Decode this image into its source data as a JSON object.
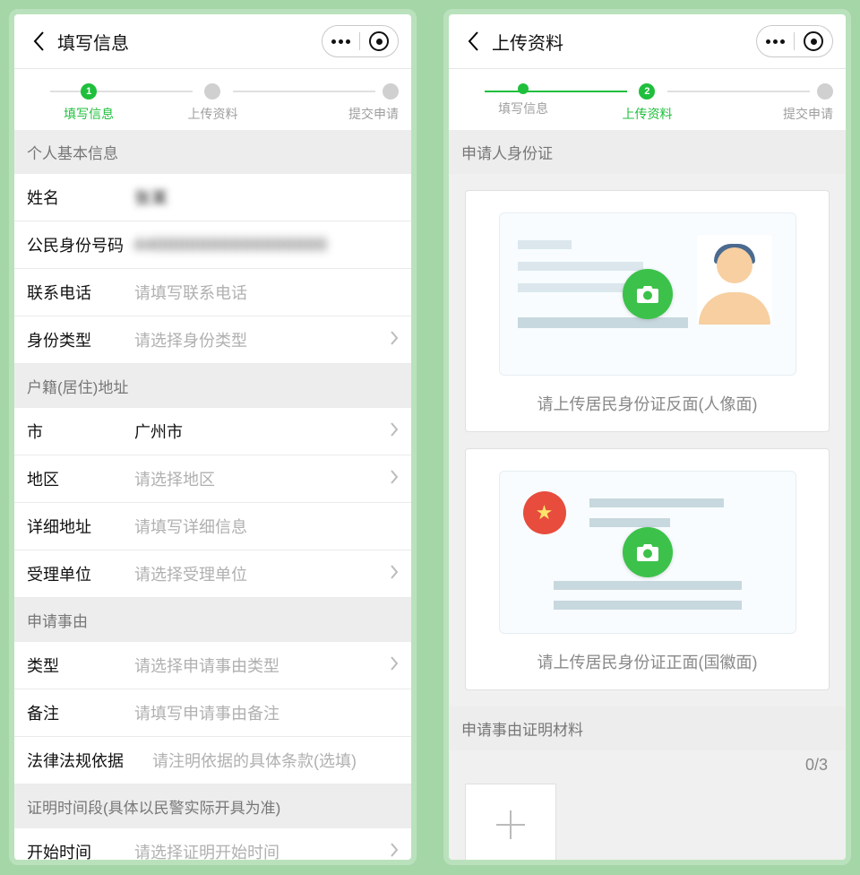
{
  "left": {
    "title": "填写信息",
    "steps": {
      "s1": {
        "num": "1",
        "label": "填写信息"
      },
      "s2": {
        "label": "上传资料"
      },
      "s3": {
        "label": "提交申请"
      }
    },
    "section_basic": "个人基本信息",
    "fields": {
      "name_label": "姓名",
      "name_value": "张某",
      "id_label": "公民身份号码",
      "id_value": "440000000000000000",
      "phone_label": "联系电话",
      "phone_placeholder": "请填写联系电话",
      "type_label": "身份类型",
      "type_placeholder": "请选择身份类型"
    },
    "section_addr": "户籍(居住)地址",
    "addr": {
      "city_label": "市",
      "city_value": "广州市",
      "dist_label": "地区",
      "dist_placeholder": "请选择地区",
      "detail_label": "详细地址",
      "detail_placeholder": "请填写详细信息",
      "unit_label": "受理单位",
      "unit_placeholder": "请选择受理单位"
    },
    "section_reason": "申请事由",
    "reason": {
      "type_label": "类型",
      "type_placeholder": "请选择申请事由类型",
      "remark_label": "备注",
      "remark_placeholder": "请填写申请事由备注",
      "law_label": "法律法规依据",
      "law_placeholder": "请注明依据的具体条款(选填)"
    },
    "section_time": "证明时间段(具体以民警实际开具为准)",
    "time": {
      "start_label": "开始时间",
      "start_placeholder": "请选择证明开始时间"
    }
  },
  "right": {
    "title": "上传资料",
    "steps": {
      "s1": {
        "label": "填写信息"
      },
      "s2": {
        "num": "2",
        "label": "上传资料"
      },
      "s3": {
        "label": "提交申请"
      }
    },
    "section_id": "申请人身份证",
    "upload_front_caption": "请上传居民身份证反面(人像面)",
    "upload_back_caption": "请上传居民身份证正面(国徽面)",
    "section_proof": "申请事由证明材料",
    "proof_counter": "0/3"
  }
}
